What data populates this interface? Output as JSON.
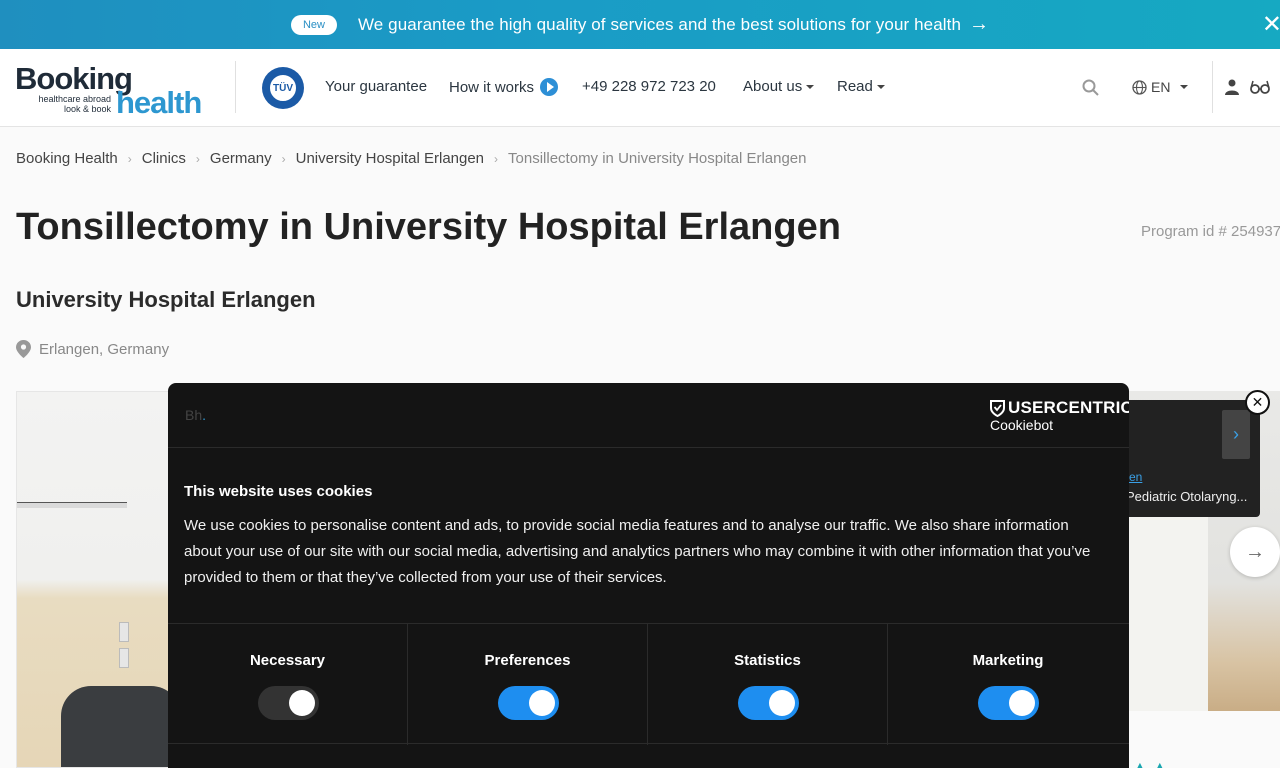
{
  "banner": {
    "badge": "New",
    "text": "We guarantee the high quality of services and the best solutions for your health",
    "arrow": "→",
    "close": "✕"
  },
  "header": {
    "logo": {
      "word1": "Booking",
      "word2": "health",
      "tagline_1": "healthcare abroad",
      "tagline_2": "look & book"
    },
    "tuv_text": "TÜV",
    "nav": [
      {
        "label": "Your guarantee"
      },
      {
        "label": "How it works"
      },
      {
        "label": "+49 228 972 723 20"
      },
      {
        "label": "About us"
      },
      {
        "label": "Read"
      }
    ],
    "language": "EN"
  },
  "breadcrumb": [
    "Booking Health",
    "Clinics",
    "Germany",
    "University Hospital Erlangen",
    "Tonsillectomy in University Hospital Erlangen"
  ],
  "page": {
    "title": "Tonsillectomy in University Hospital Erlangen",
    "program_id": "Program id # 254937",
    "hospital": "University Hospital Erlangen",
    "location": "Erlangen, Germany"
  },
  "doctor_card": {
    "name": "en",
    "specialty": "Pediatric Otolaryng..."
  },
  "cookie": {
    "bh_logo_b": "Bh",
    "bh_logo_dot": ".",
    "brand": "USERCENTRICS",
    "brand_sub": "Cookiebot",
    "heading": "This website uses cookies",
    "text": "We use cookies to personalise content and ads, to provide social media features and to analyse our traffic. We also share information about your use of our site with our social media, advertising and analytics partners who may combine it with other information that you’ve provided to them or that they’ve collected from your use of their services.",
    "toggles": [
      {
        "label": "Necessary",
        "on": true,
        "disabled": true
      },
      {
        "label": "Preferences",
        "on": true,
        "disabled": false
      },
      {
        "label": "Statistics",
        "on": true,
        "disabled": false
      },
      {
        "label": "Marketing",
        "on": true,
        "disabled": false
      }
    ]
  },
  "colors": {
    "accent": "#1e8ef0",
    "banner": "#1a9bc6",
    "dialog_bg": "#141414"
  }
}
